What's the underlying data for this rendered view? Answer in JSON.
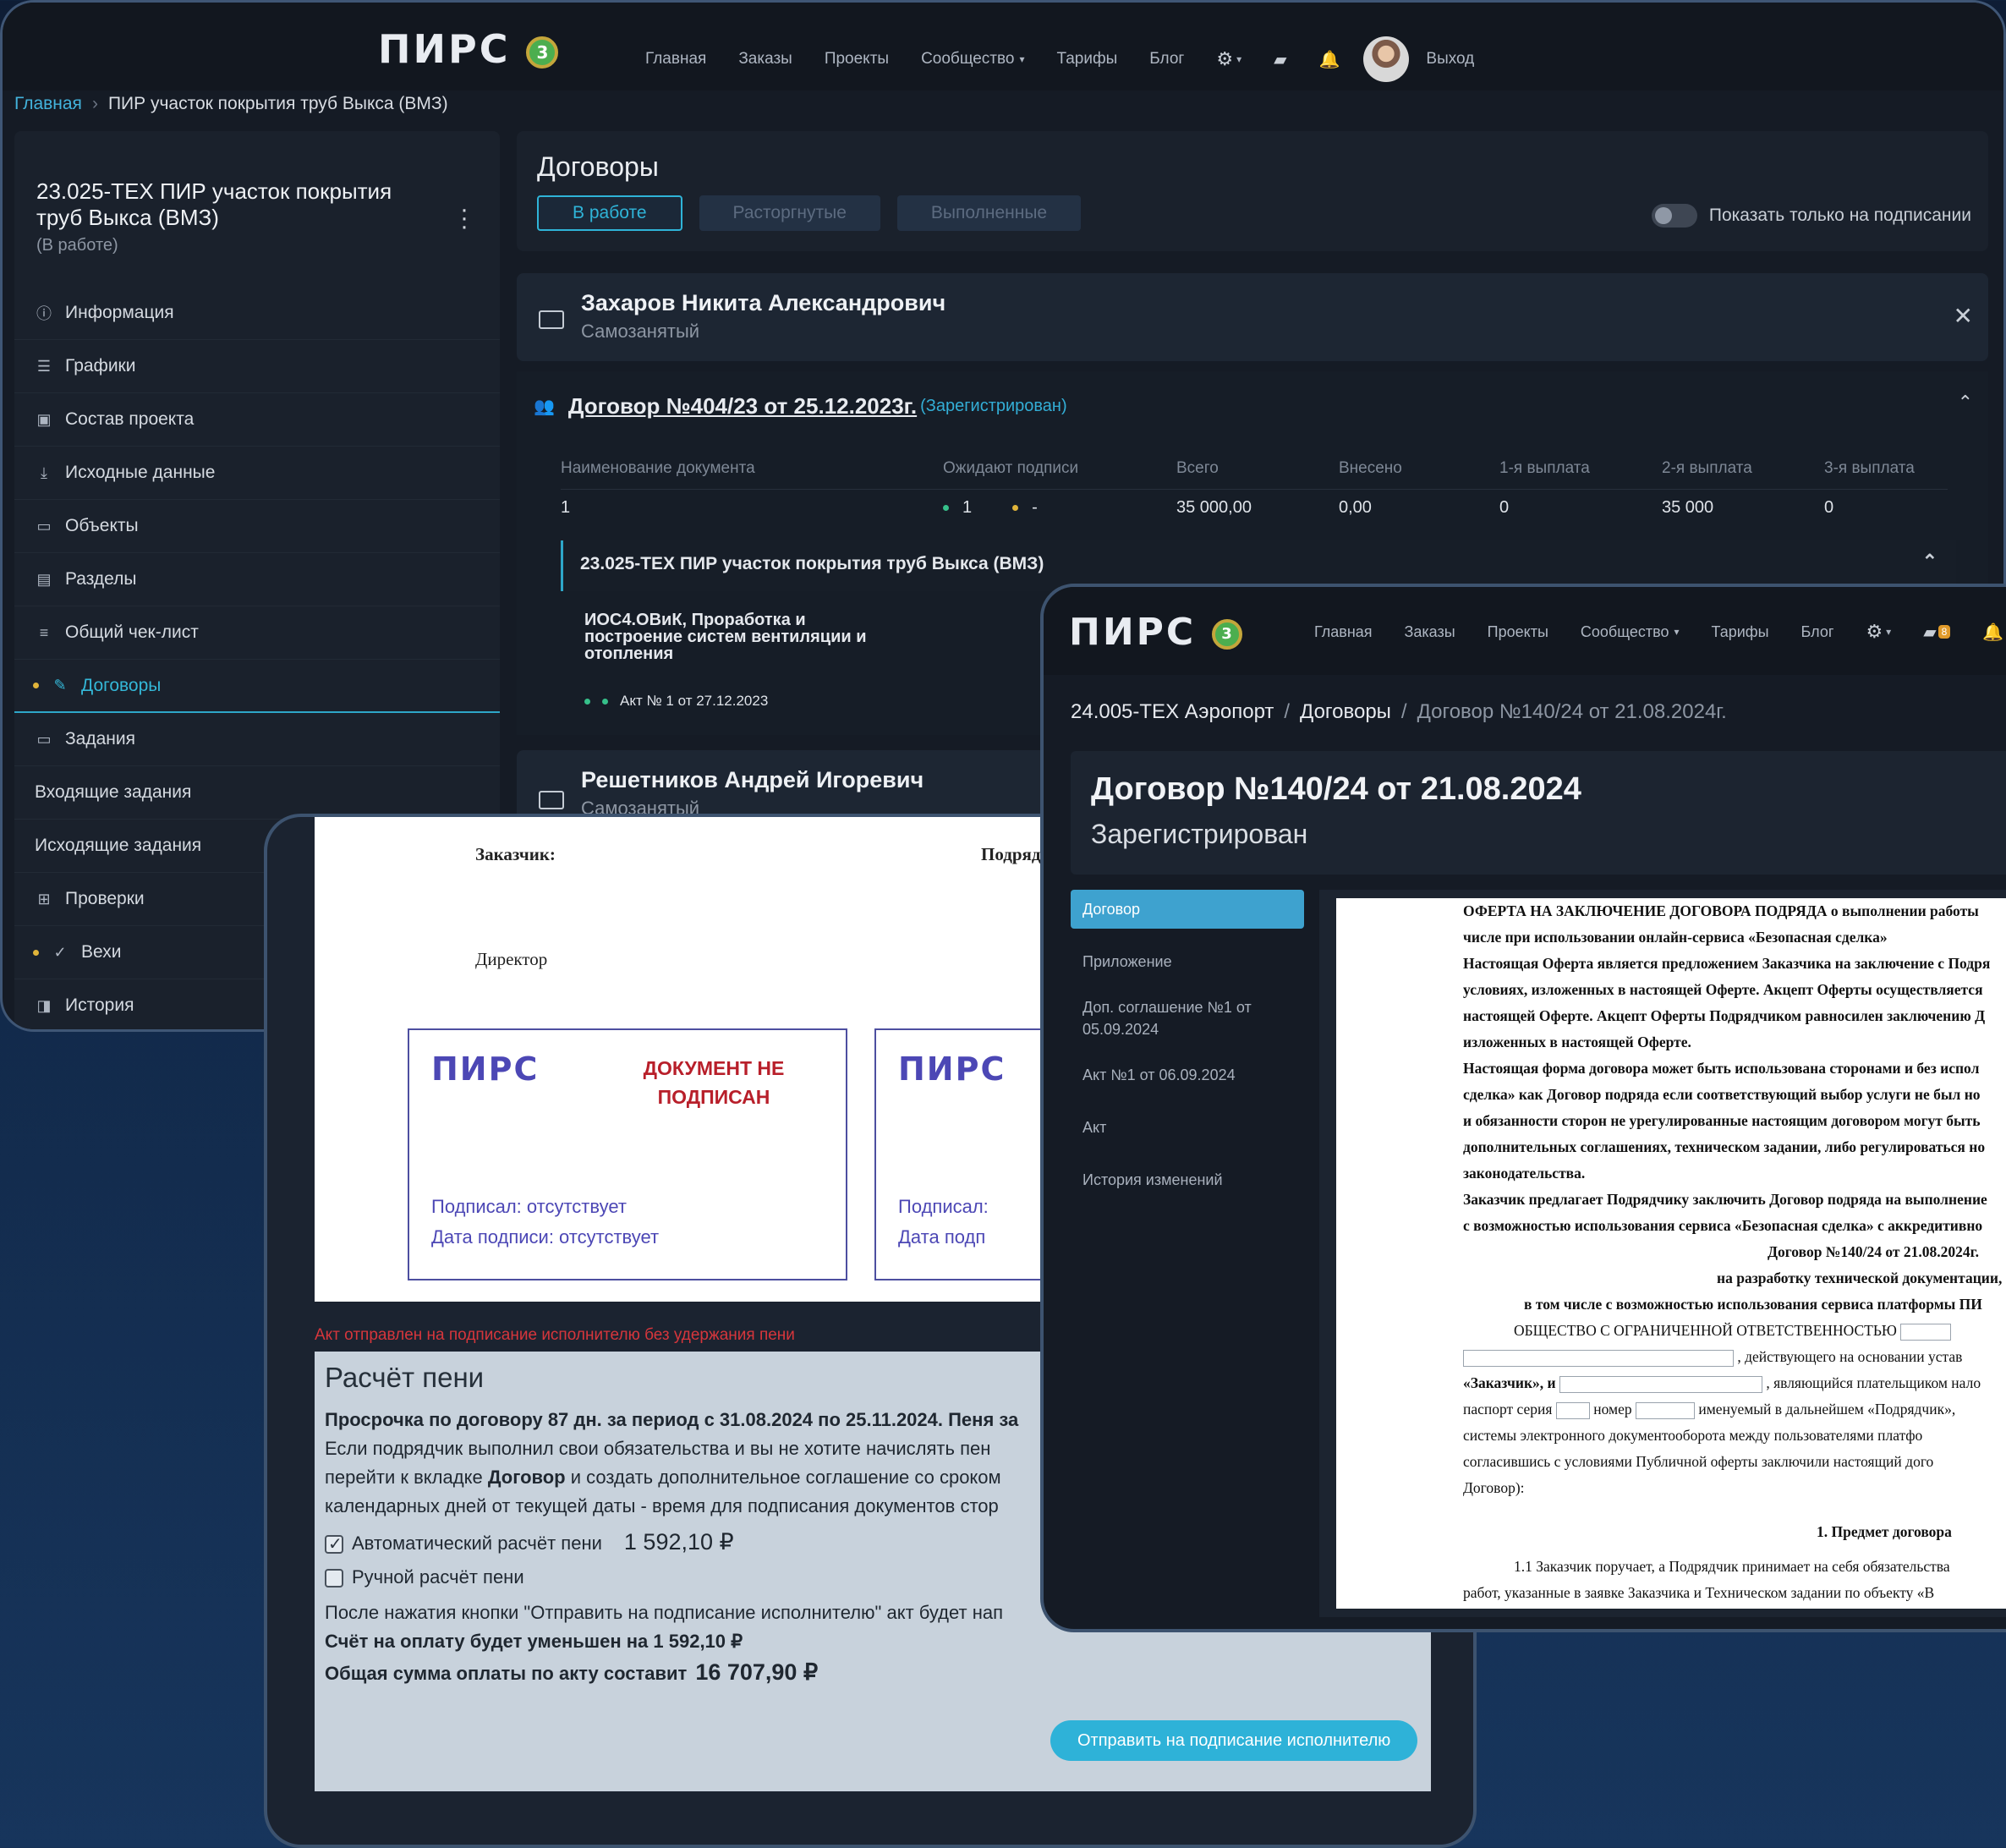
{
  "logo": {
    "text": "ПИРС",
    "badge": "3"
  },
  "nav": {
    "items": [
      "Главная",
      "Заказы",
      "Проекты",
      "Сообщество",
      "Тарифы",
      "Блог"
    ],
    "logout": "Выход",
    "message_count": "8"
  },
  "window1": {
    "breadcrumb": {
      "home": "Главная",
      "current": "ПИР участок покрытия труб Выкса (ВМЗ)"
    },
    "project": {
      "title": "23.025-ТЕХ ПИР участок покрытия труб Выкса (ВМЗ)",
      "status": "(В работе)"
    },
    "sidebar": [
      {
        "label": "Информация",
        "icon": "info-icon"
      },
      {
        "label": "Графики",
        "icon": "gantt-icon"
      },
      {
        "label": "Состав проекта",
        "icon": "clipboard-icon"
      },
      {
        "label": "Исходные данные",
        "icon": "download-icon"
      },
      {
        "label": "Объекты",
        "icon": "folder-icon"
      },
      {
        "label": "Разделы",
        "icon": "sections-icon"
      },
      {
        "label": "Общий чек-лист",
        "icon": "checklist-icon"
      },
      {
        "label": "Договоры",
        "icon": "pen-icon"
      },
      {
        "label": "Задания",
        "icon": "tasks-icon"
      },
      {
        "label": "Входящие задания",
        "icon": ""
      },
      {
        "label": "Исходящие задания",
        "icon": ""
      },
      {
        "label": "Проверки",
        "icon": "grid-icon"
      },
      {
        "label": "Вехи",
        "icon": "check-circle-icon"
      },
      {
        "label": "История",
        "icon": "history-icon"
      }
    ],
    "contracts": {
      "title": "Договоры",
      "tabs": [
        "В работе",
        "Расторгнутые",
        "Выполненные"
      ],
      "toggle_label": "Показать только на подписании",
      "executor1": {
        "name": "Захаров Никита Александрович",
        "type": "Самозанятый"
      },
      "contract": {
        "number": "Договор №404/23 от 25.12.2023г.",
        "status": "(Зарегистрирован)"
      },
      "table_headers": [
        "Наименование документа",
        "Ожидают подписи",
        "Всего",
        "Внесено",
        "1-я выплата",
        "2-я выплата",
        "3-я выплата"
      ],
      "table_row": [
        "1",
        "1",
        "-",
        "35 000,00",
        "0,00",
        "0",
        "35 000",
        "0"
      ],
      "subproject": "23.025-ТЕХ ПИР участок покрытия труб Выкса (ВМЗ)",
      "doc_name": "ИОС4.ОВиК, Проработка и построение систем вентиляции и отопления",
      "doc_count": "1",
      "act": "Акт № 1 от 27.12.2023",
      "executor2": {
        "name": "Решетников Андрей Игоревич",
        "type": "Самозанятый"
      }
    }
  },
  "window2": {
    "customer": "Заказчик:",
    "contractor": "Подрядчик:",
    "director": "Директор",
    "stamp1": {
      "logo": "ПИРС",
      "warning": "ДОКУМЕНТ НЕ ПОДПИСАН",
      "signed": "Подписал: отсутствует",
      "date": "Дата подписи: отсутствует"
    },
    "stamp2": {
      "logo": "ПИРС",
      "signed": "Подписал:",
      "date": "Дата подп"
    },
    "note": "Акт отправлен на подписание исполнителю без удержания пени",
    "penalty": {
      "title": "Расчёт пени",
      "overdue": "Просрочка по договору 87 дн. за период с 31.08.2024 по 25.11.2024. Пеня за",
      "desc1": "Если подрядчик выполнил свои обязательства и вы не хотите начислять пен",
      "desc2_pre": "перейти к вкладке ",
      "desc2_bold": "Договор",
      "desc2_post": " и создать дополнительное соглашение со сроком",
      "desc3": "календарных дней от текущей даты - время для подписания документов стор",
      "auto_label": "Автоматический расчёт пени",
      "auto_amount": "1 592,10 ₽",
      "manual_label": "Ручной расчёт пени",
      "after_send": "После нажатия кнопки \"Отправить на подписание исполнителю\" акт будет нап",
      "invoice_reduced": "Счёт на оплату будет уменьшен на 1 592,10 ₽",
      "total_label": "Общая сумма оплаты по акту составит",
      "total_amount": "16 707,90 ₽",
      "send_button": "Отправить на подписание исполнителю"
    }
  },
  "window3": {
    "breadcrumb": [
      "24.005-ТЕХ Аэропорт",
      "Договоры",
      "Договор №140/24 от 21.08.2024г."
    ],
    "title": "Договор №140/24 от 21.08.2024",
    "status": "Зарегистрирован",
    "tabs": [
      "Договор",
      "Приложение",
      "Доп. соглашение №1 от 05.09.2024",
      "Акт №1 от 06.09.2024",
      "Акт",
      "История изменений"
    ],
    "doc_lines": [
      "ОФЕРТА НА ЗАКЛЮЧЕНИЕ ДОГОВОРА ПОДРЯДА о выполнении работы",
      "числе при использовании онлайн-сервиса «Безопасная сделка»",
      "Настоящая Оферта является предложением Заказчика на заключение с Подря",
      "условиях, изложенных в настоящей Оферте. Акцепт Оферты осуществляется",
      "настоящей Оферте. Акцепт Оферты Подрядчиком равносилен заключению Д",
      "изложенных в настоящей Оферте.",
      "Настоящая форма договора может быть использована сторонами и без испол",
      "сделка» как Договор подряда если соответствующий выбор услуги не был но",
      "и обязанности сторон не урегулированные настоящим договором могут быть",
      "дополнительных соглашениях, техническом задании, либо регулироваться но",
      "законодательства.",
      "Заказчик предлагает Подрядчику заключить Договор подряда на выполнение",
      "с возможностью использования сервиса «Безопасная сделка» с аккредитивно",
      "Договор №140/24 от 21.08.2024г.",
      "на разработку технической документации,",
      "в том числе с возможностью использования сервиса платформы ПИ",
      "ОБЩЕСТВО С ОГРАНИЧЕННОЙ ОТВЕТСТВЕННОСТЬЮ",
      ", действующего на основании устав",
      "«Заказчик», и",
      ", являющийся плательщиком нало",
      "паспорт серия",
      "номер",
      "именуемый в дальнейшем «Подрядчик»,",
      "системы электронного документооборота между пользователями платфо",
      "согласившись с условиями Публичной оферты заключили настоящий дого",
      "Договор):",
      "1. Предмет договора",
      "1.1 Заказчик поручает, а Подрядчик принимает на себя обязательства",
      "работ, указанные в заявке Заказчика и Техническом задании по объекту «В"
    ]
  }
}
